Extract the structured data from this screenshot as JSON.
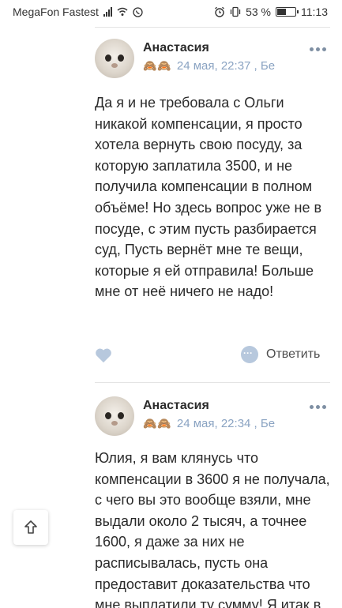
{
  "status_bar": {
    "carrier": "MegaFon Fastest",
    "battery_percent": "53 %",
    "battery_level": 0.53,
    "time": "11:13"
  },
  "comments": [
    {
      "author": "Анастасия",
      "badges": "🙈🙈",
      "timestamp": "24 мая, 22:37 , Бе",
      "text": "Да я и не требовала с Ольги никакой компенсации, я просто хотела вернуть свою посуду, за которую заплатила 3500, и не получила компенсации в полном объёме! Но здесь вопрос уже не в посуде, с этим пусть разбирается суд, Пусть вернёт мне те вещи, которые я ей отправила! Больше мне от неё ничего не надо!",
      "reply_label": "Ответить"
    },
    {
      "author": "Анастасия",
      "badges": "🙈🙈",
      "timestamp": "24 мая, 22:34 , Бе",
      "text": "Юлия, я вам клянусь что компенсации в 3600 я не получала, с чего вы это вообще взяли, мне выдали около 2 тысяч, а точнее 1600, я даже за них не расписывалась, пусть она предоставит доказательства что мне выплатили ту сумму! Я итак в"
    }
  ],
  "colors": {
    "accent": "#8aa3c2",
    "like": "#b7c8dd"
  }
}
